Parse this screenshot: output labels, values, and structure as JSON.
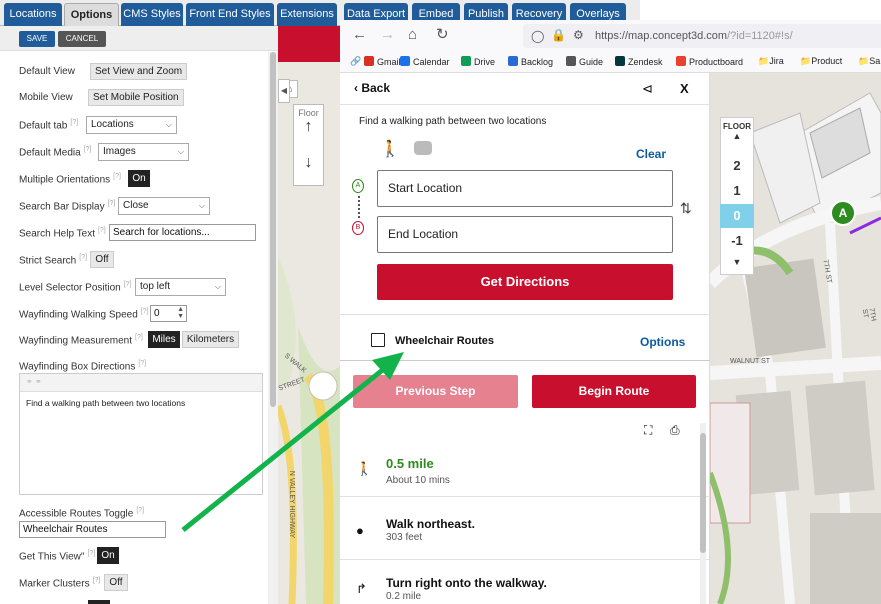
{
  "admin": {
    "tabs": [
      {
        "label": "Locations",
        "active": false
      },
      {
        "label": "Options",
        "active": true
      },
      {
        "label": "CMS Styles",
        "active": false
      },
      {
        "label": "Front End Styles",
        "active": false
      },
      {
        "label": "Extensions",
        "active": false
      },
      {
        "label": "Data Export",
        "active": false
      },
      {
        "label": "Embed",
        "active": false
      },
      {
        "label": "Publish",
        "active": false
      },
      {
        "label": "Recovery",
        "active": false
      },
      {
        "label": "Overlays",
        "active": false
      }
    ],
    "save_label": "SAVE",
    "cancel_label": "CANCEL",
    "help_marker": "[?]",
    "fields": {
      "default_view": {
        "label": "Default View",
        "button": "Set View and Zoom"
      },
      "mobile_view": {
        "label": "Mobile View",
        "button": "Set Mobile Position"
      },
      "default_tab": {
        "label": "Default tab",
        "value": "Locations"
      },
      "default_media": {
        "label": "Default Media",
        "value": "Images"
      },
      "multiple_orientations": {
        "label": "Multiple Orientations",
        "value": "On"
      },
      "search_bar_display": {
        "label": "Search Bar Display",
        "value": "Close"
      },
      "search_help_text": {
        "label": "Search Help Text",
        "value": "Search for locations..."
      },
      "strict_search": {
        "label": "Strict Search",
        "value": "Off"
      },
      "level_selector_position": {
        "label": "Level Selector Position",
        "value": "top left"
      },
      "walking_speed": {
        "label": "Wayfinding Walking Speed",
        "value": "0"
      },
      "measurement": {
        "label": "Wayfinding Measurement",
        "option_a": "Miles",
        "option_b": "Kilometers"
      },
      "box_directions": {
        "label": "Wayfinding Box Directions",
        "value": "Find a walking path between two locations"
      },
      "accessible_toggle": {
        "label": "Accessible Routes Toggle",
        "value": "Wheelchair Routes"
      },
      "get_this_view": {
        "label": "Get This View\"",
        "value": "On"
      },
      "marker_clusters": {
        "label": "Marker Clusters",
        "value": "Off"
      }
    }
  },
  "browser": {
    "url_host": "https://map.concept3d.com",
    "url_path": "/?id=1120#!s/",
    "bookmarks": [
      {
        "label": "Gmail",
        "color": "#d93025"
      },
      {
        "label": "Calendar",
        "color": "#1a73e8"
      },
      {
        "label": "Drive",
        "color": "#0f9d58"
      },
      {
        "label": "Backlog",
        "color": "#2a6ad4"
      },
      {
        "label": "Guide",
        "color": "#555555"
      },
      {
        "label": "Zendesk",
        "color": "#03363d"
      },
      {
        "label": "Productboard",
        "color": "#e8412d"
      },
      {
        "label": "Jira",
        "color": "#444444"
      },
      {
        "label": "Product",
        "color": "#444444"
      },
      {
        "label": "Sa",
        "color": "#444444"
      }
    ]
  },
  "wayfinding": {
    "back_label": "Back",
    "close_label": "X",
    "heading": "Find a walking path between two locations",
    "clear_label": "Clear",
    "start_placeholder": "Start Location",
    "end_placeholder": "End Location",
    "start_marker": "A",
    "end_marker": "B",
    "get_directions_label": "Get Directions",
    "wheelchair_label": "Wheelchair Routes",
    "options_label": "Options",
    "previous_step_label": "Previous Step",
    "begin_route_label": "Begin Route",
    "summary_distance": "0.5 mile",
    "summary_time": "About 10 mins",
    "steps": [
      {
        "title": "Walk northeast.",
        "distance": "303 feet"
      },
      {
        "title": "Turn right onto the walkway.",
        "distance": "0.2 mile"
      }
    ]
  },
  "map": {
    "floor_label": "Floor",
    "floor_title": "FLOOR",
    "floors": [
      "2",
      "1",
      "0",
      "-1"
    ],
    "active_floor": "0",
    "marker_label": "A",
    "street_labels": [
      "WALKER ST",
      "WALNUT ST",
      "7TH ST",
      "7TH ST",
      "N VALLEY HIGHWAY",
      "STREET",
      "S WALK"
    ]
  },
  "colors": {
    "admin_tab": "#1f5c99",
    "brand_red": "#c8102e",
    "accent_blue": "#0c5a9e",
    "green": "#2e8b1f",
    "annotation_arrow": "#12b34a"
  }
}
